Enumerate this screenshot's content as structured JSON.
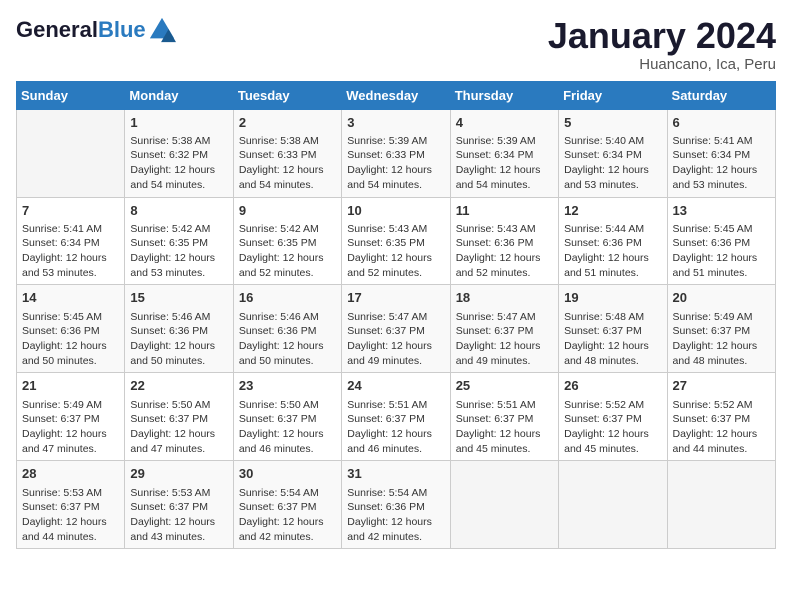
{
  "header": {
    "logo_line1": "General",
    "logo_line2": "Blue",
    "month": "January 2024",
    "location": "Huancano, Ica, Peru"
  },
  "days_of_week": [
    "Sunday",
    "Monday",
    "Tuesday",
    "Wednesday",
    "Thursday",
    "Friday",
    "Saturday"
  ],
  "weeks": [
    [
      {
        "day": "",
        "info": ""
      },
      {
        "day": "1",
        "info": "Sunrise: 5:38 AM\nSunset: 6:32 PM\nDaylight: 12 hours\nand 54 minutes."
      },
      {
        "day": "2",
        "info": "Sunrise: 5:38 AM\nSunset: 6:33 PM\nDaylight: 12 hours\nand 54 minutes."
      },
      {
        "day": "3",
        "info": "Sunrise: 5:39 AM\nSunset: 6:33 PM\nDaylight: 12 hours\nand 54 minutes."
      },
      {
        "day": "4",
        "info": "Sunrise: 5:39 AM\nSunset: 6:34 PM\nDaylight: 12 hours\nand 54 minutes."
      },
      {
        "day": "5",
        "info": "Sunrise: 5:40 AM\nSunset: 6:34 PM\nDaylight: 12 hours\nand 53 minutes."
      },
      {
        "day": "6",
        "info": "Sunrise: 5:41 AM\nSunset: 6:34 PM\nDaylight: 12 hours\nand 53 minutes."
      }
    ],
    [
      {
        "day": "7",
        "info": "Sunrise: 5:41 AM\nSunset: 6:34 PM\nDaylight: 12 hours\nand 53 minutes."
      },
      {
        "day": "8",
        "info": "Sunrise: 5:42 AM\nSunset: 6:35 PM\nDaylight: 12 hours\nand 53 minutes."
      },
      {
        "day": "9",
        "info": "Sunrise: 5:42 AM\nSunset: 6:35 PM\nDaylight: 12 hours\nand 52 minutes."
      },
      {
        "day": "10",
        "info": "Sunrise: 5:43 AM\nSunset: 6:35 PM\nDaylight: 12 hours\nand 52 minutes."
      },
      {
        "day": "11",
        "info": "Sunrise: 5:43 AM\nSunset: 6:36 PM\nDaylight: 12 hours\nand 52 minutes."
      },
      {
        "day": "12",
        "info": "Sunrise: 5:44 AM\nSunset: 6:36 PM\nDaylight: 12 hours\nand 51 minutes."
      },
      {
        "day": "13",
        "info": "Sunrise: 5:45 AM\nSunset: 6:36 PM\nDaylight: 12 hours\nand 51 minutes."
      }
    ],
    [
      {
        "day": "14",
        "info": "Sunrise: 5:45 AM\nSunset: 6:36 PM\nDaylight: 12 hours\nand 50 minutes."
      },
      {
        "day": "15",
        "info": "Sunrise: 5:46 AM\nSunset: 6:36 PM\nDaylight: 12 hours\nand 50 minutes."
      },
      {
        "day": "16",
        "info": "Sunrise: 5:46 AM\nSunset: 6:36 PM\nDaylight: 12 hours\nand 50 minutes."
      },
      {
        "day": "17",
        "info": "Sunrise: 5:47 AM\nSunset: 6:37 PM\nDaylight: 12 hours\nand 49 minutes."
      },
      {
        "day": "18",
        "info": "Sunrise: 5:47 AM\nSunset: 6:37 PM\nDaylight: 12 hours\nand 49 minutes."
      },
      {
        "day": "19",
        "info": "Sunrise: 5:48 AM\nSunset: 6:37 PM\nDaylight: 12 hours\nand 48 minutes."
      },
      {
        "day": "20",
        "info": "Sunrise: 5:49 AM\nSunset: 6:37 PM\nDaylight: 12 hours\nand 48 minutes."
      }
    ],
    [
      {
        "day": "21",
        "info": "Sunrise: 5:49 AM\nSunset: 6:37 PM\nDaylight: 12 hours\nand 47 minutes."
      },
      {
        "day": "22",
        "info": "Sunrise: 5:50 AM\nSunset: 6:37 PM\nDaylight: 12 hours\nand 47 minutes."
      },
      {
        "day": "23",
        "info": "Sunrise: 5:50 AM\nSunset: 6:37 PM\nDaylight: 12 hours\nand 46 minutes."
      },
      {
        "day": "24",
        "info": "Sunrise: 5:51 AM\nSunset: 6:37 PM\nDaylight: 12 hours\nand 46 minutes."
      },
      {
        "day": "25",
        "info": "Sunrise: 5:51 AM\nSunset: 6:37 PM\nDaylight: 12 hours\nand 45 minutes."
      },
      {
        "day": "26",
        "info": "Sunrise: 5:52 AM\nSunset: 6:37 PM\nDaylight: 12 hours\nand 45 minutes."
      },
      {
        "day": "27",
        "info": "Sunrise: 5:52 AM\nSunset: 6:37 PM\nDaylight: 12 hours\nand 44 minutes."
      }
    ],
    [
      {
        "day": "28",
        "info": "Sunrise: 5:53 AM\nSunset: 6:37 PM\nDaylight: 12 hours\nand 44 minutes."
      },
      {
        "day": "29",
        "info": "Sunrise: 5:53 AM\nSunset: 6:37 PM\nDaylight: 12 hours\nand 43 minutes."
      },
      {
        "day": "30",
        "info": "Sunrise: 5:54 AM\nSunset: 6:37 PM\nDaylight: 12 hours\nand 42 minutes."
      },
      {
        "day": "31",
        "info": "Sunrise: 5:54 AM\nSunset: 6:36 PM\nDaylight: 12 hours\nand 42 minutes."
      },
      {
        "day": "",
        "info": ""
      },
      {
        "day": "",
        "info": ""
      },
      {
        "day": "",
        "info": ""
      }
    ]
  ]
}
